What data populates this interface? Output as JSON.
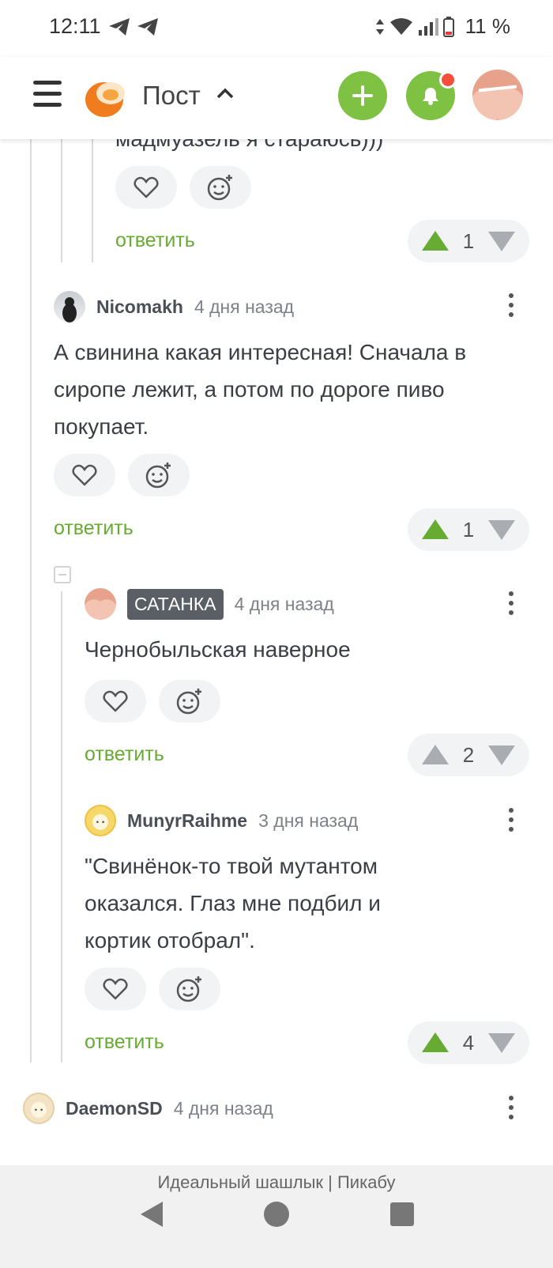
{
  "status_bar": {
    "time": "12:11",
    "battery": "11 %"
  },
  "header": {
    "title": "Пост"
  },
  "partial_comment": {
    "text_tail": "мадмуазель я стараюсь)))",
    "reply_label": "ответить",
    "rating": "1"
  },
  "comments": [
    {
      "author": "Nicomakh",
      "time": "4 дня назад",
      "text": "А свинина какая интересная! Сначала в сиропе лежит, а потом по дороге пиво покупает.",
      "reply_label": "ответить",
      "rating": "1"
    },
    {
      "author": "САТАНКА",
      "time": "4 дня назад",
      "text": "Чернобыльская наверное",
      "reply_label": "ответить",
      "rating": "2"
    },
    {
      "author": "MunyrRaihme",
      "time": "3 дня назад",
      "text": "\"Свинёнок-то твой мутантом оказался. Глаз мне подбил и кортик отобрал\".",
      "reply_label": "ответить",
      "rating": "4"
    },
    {
      "author": "DaemonSD",
      "time": "4 дня назад"
    }
  ],
  "page_footer": {
    "title": "Идеальный шашлык | Пикабу"
  },
  "icons": {
    "like": "heart-icon",
    "react": "add-emoji-icon",
    "upvote": "upvote-arrow-icon",
    "downvote": "downvote-arrow-icon"
  },
  "colors": {
    "accent_green": "#7fc243",
    "reply_green": "#67ab32",
    "notification_dot": "#f44f3a"
  }
}
